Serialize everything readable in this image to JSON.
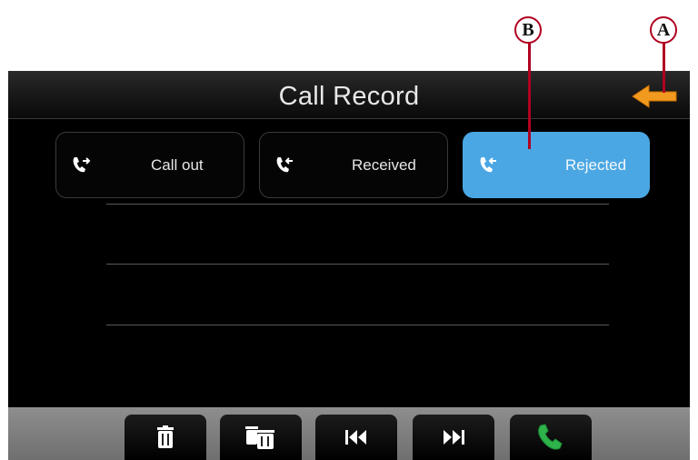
{
  "header": {
    "title": "Call Record"
  },
  "tabs": [
    {
      "label": "Call out",
      "icon": "phone-outgoing-icon",
      "active": false
    },
    {
      "label": "Received",
      "icon": "phone-incoming-icon",
      "active": false
    },
    {
      "label": "Rejected",
      "icon": "phone-rejected-icon",
      "active": true
    }
  ],
  "toolbar": {
    "buttons": [
      "trash-icon",
      "trash-all-icon",
      "previous-page-icon",
      "next-page-icon",
      "call-icon"
    ]
  },
  "annotations": {
    "a": "A",
    "b": "B"
  },
  "colors": {
    "active_tab": "#4aa7e3",
    "back_arrow": "#f29a1f",
    "call_green": "#2db34a",
    "callout_red": "#b00020"
  }
}
